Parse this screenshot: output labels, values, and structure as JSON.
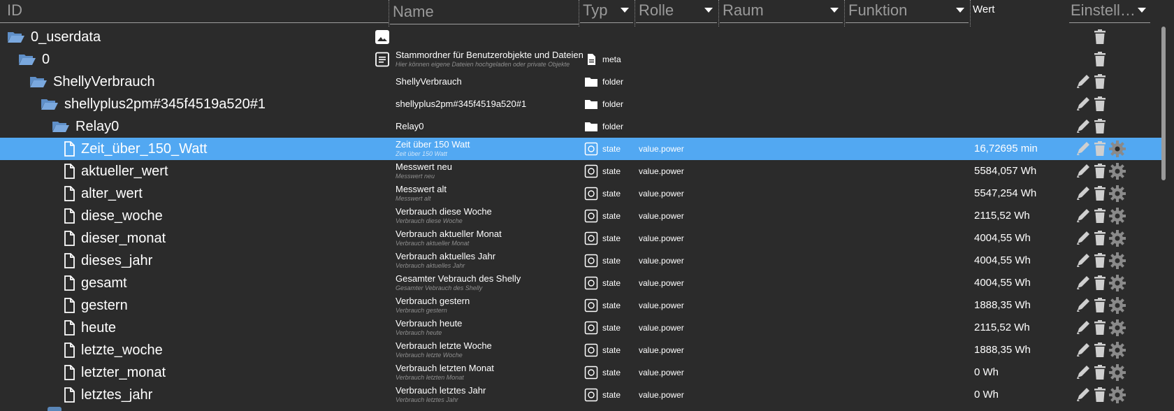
{
  "columns": {
    "id": "ID",
    "name": "Name",
    "type": "Typ",
    "role": "Rolle",
    "room": "Raum",
    "function": "Funktion",
    "value": "Wert",
    "settings": "Einstell…"
  },
  "colors": {
    "background": "#2b2b2b",
    "selected_row": "#52a8f2",
    "folder_icon": "#6b9bd2"
  },
  "rows": [
    {
      "id": "0_userdata",
      "icon": "folder-open-icon",
      "level": 0,
      "name": "",
      "name_sub": "",
      "type": "",
      "type_icon": "",
      "role": "",
      "value": "",
      "actions": [
        "delete"
      ],
      "extra_icon": "image-icon"
    },
    {
      "id": "0",
      "icon": "folder-open-icon",
      "level": 1,
      "name": "Stammordner für Benutzerobjekte und Dateien",
      "name_sub": "Hier können eigene Dateien hochgeladen oder private Objekte",
      "type": "meta",
      "type_icon": "file-icon",
      "role": "",
      "value": "",
      "actions": [
        "delete"
      ],
      "extra_icon": "description-icon"
    },
    {
      "id": "ShellyVerbrauch",
      "icon": "folder-open-icon",
      "level": 2,
      "name": "ShellyVerbrauch",
      "name_sub": "",
      "type": "folder",
      "type_icon": "folder-icon",
      "role": "",
      "value": "",
      "actions": [
        "edit",
        "delete"
      ]
    },
    {
      "id": "shellyplus2pm#345f4519a520#1",
      "icon": "folder-open-icon",
      "level": 3,
      "name": "shellyplus2pm#345f4519a520#1",
      "name_sub": "",
      "type": "folder",
      "type_icon": "folder-icon",
      "role": "",
      "value": "",
      "actions": [
        "edit",
        "delete"
      ]
    },
    {
      "id": "Relay0",
      "icon": "folder-open-icon",
      "level": 4,
      "name": "Relay0",
      "name_sub": "",
      "type": "folder",
      "type_icon": "folder-icon",
      "role": "",
      "value": "",
      "actions": [
        "edit",
        "delete"
      ]
    },
    {
      "id": "Zeit_über_150_Watt",
      "icon": "file-icon",
      "level": 5,
      "name": "Zeit über 150 Watt",
      "name_sub": "Zeit über 150 Watt",
      "type": "state",
      "type_icon": "state-icon",
      "role": "value.power",
      "value": "16,72695 min",
      "actions": [
        "edit",
        "delete",
        "settings"
      ],
      "selected": true
    },
    {
      "id": "aktueller_wert",
      "icon": "file-icon",
      "level": 5,
      "name": "Messwert neu",
      "name_sub": "Messwert neu",
      "type": "state",
      "type_icon": "state-icon",
      "role": "value.power",
      "value": "5584,057 Wh",
      "actions": [
        "edit",
        "delete",
        "settings"
      ]
    },
    {
      "id": "alter_wert",
      "icon": "file-icon",
      "level": 5,
      "name": "Messwert alt",
      "name_sub": "Messwert alt",
      "type": "state",
      "type_icon": "state-icon",
      "role": "value.power",
      "value": "5547,254 Wh",
      "actions": [
        "edit",
        "delete",
        "settings"
      ]
    },
    {
      "id": "diese_woche",
      "icon": "file-icon",
      "level": 5,
      "name": "Verbrauch diese Woche",
      "name_sub": "Verbrauch diese Woche",
      "type": "state",
      "type_icon": "state-icon",
      "role": "value.power",
      "value": "2115,52 Wh",
      "actions": [
        "edit",
        "delete",
        "settings"
      ]
    },
    {
      "id": "dieser_monat",
      "icon": "file-icon",
      "level": 5,
      "name": "Verbrauch aktueller Monat",
      "name_sub": "Verbrauch aktueller Monat",
      "type": "state",
      "type_icon": "state-icon",
      "role": "value.power",
      "value": "4004,55 Wh",
      "actions": [
        "edit",
        "delete",
        "settings"
      ]
    },
    {
      "id": "dieses_jahr",
      "icon": "file-icon",
      "level": 5,
      "name": "Verbrauch aktuelles Jahr",
      "name_sub": "Verbrauch aktuelles Jahr",
      "type": "state",
      "type_icon": "state-icon",
      "role": "value.power",
      "value": "4004,55 Wh",
      "actions": [
        "edit",
        "delete",
        "settings"
      ]
    },
    {
      "id": "gesamt",
      "icon": "file-icon",
      "level": 5,
      "name": "Gesamter Vebrauch des Shelly",
      "name_sub": "Gesamter Vebrauch des Shelly",
      "type": "state",
      "type_icon": "state-icon",
      "role": "value.power",
      "value": "4004,55 Wh",
      "actions": [
        "edit",
        "delete",
        "settings"
      ]
    },
    {
      "id": "gestern",
      "icon": "file-icon",
      "level": 5,
      "name": "Verbrauch gestern",
      "name_sub": "Verbrauch gestern",
      "type": "state",
      "type_icon": "state-icon",
      "role": "value.power",
      "value": "1888,35 Wh",
      "actions": [
        "edit",
        "delete",
        "settings"
      ]
    },
    {
      "id": "heute",
      "icon": "file-icon",
      "level": 5,
      "name": "Verbrauch heute",
      "name_sub": "Verbrauch heute",
      "type": "state",
      "type_icon": "state-icon",
      "role": "value.power",
      "value": "2115,52 Wh",
      "actions": [
        "edit",
        "delete",
        "settings"
      ]
    },
    {
      "id": "letzte_woche",
      "icon": "file-icon",
      "level": 5,
      "name": "Verbrauch letzte Woche",
      "name_sub": "Verbrauch letzte Woche",
      "type": "state",
      "type_icon": "state-icon",
      "role": "value.power",
      "value": "1888,35 Wh",
      "actions": [
        "edit",
        "delete",
        "settings"
      ]
    },
    {
      "id": "letzter_monat",
      "icon": "file-icon",
      "level": 5,
      "name": "Verbrauch letzten Monat",
      "name_sub": "Verbrauch letzten Monat",
      "type": "state",
      "type_icon": "state-icon",
      "role": "value.power",
      "value": "0 Wh",
      "actions": [
        "edit",
        "delete",
        "settings"
      ]
    },
    {
      "id": "letztes_jahr",
      "icon": "file-icon",
      "level": 5,
      "name": "Verbrauch letztes Jahr",
      "name_sub": "Verbrauch letztes Jahr",
      "type": "state",
      "type_icon": "state-icon",
      "role": "value.power",
      "value": "0 Wh",
      "actions": [
        "edit",
        "delete",
        "settings"
      ]
    }
  ]
}
